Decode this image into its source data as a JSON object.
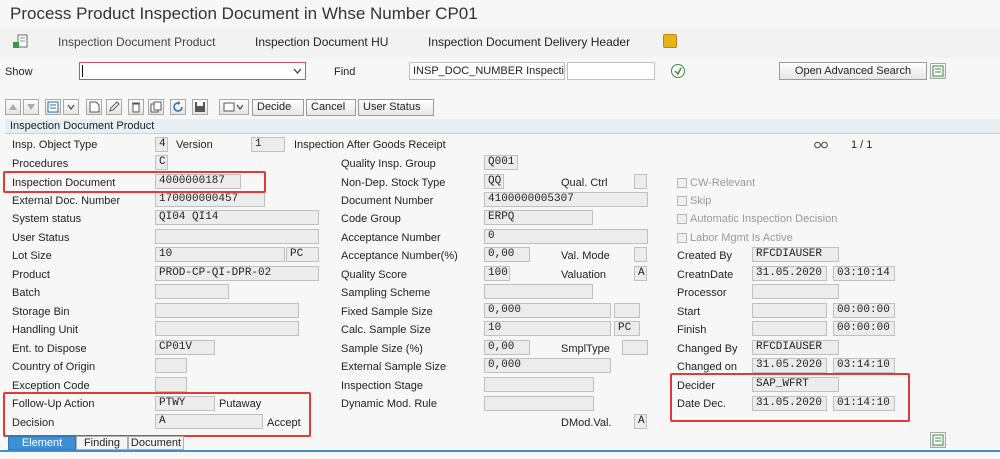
{
  "app": {
    "title": "Process Product Inspection Document in Whse Number CP01"
  },
  "nav": {
    "items": [
      "Inspection Document Product",
      "Inspection Document HU",
      "Inspection Document Delivery Header"
    ]
  },
  "search": {
    "show_label": "Show",
    "show_value": "",
    "find_label": "Find",
    "find_field": "INSP_DOC_NUMBER Inspecti…",
    "find_value": "",
    "advanced_label": "Open Advanced Search"
  },
  "toolbar": {
    "decide": "Decide",
    "cancel": "Cancel",
    "user_status": "User Status"
  },
  "panel": {
    "title": "Inspection Document Product",
    "pager": "1 / 1"
  },
  "top": {
    "insp_object_type_label": "Insp. Object Type",
    "insp_object_type": "4",
    "version_label": "Version",
    "version": "1",
    "description": "Inspection After Goods Receipt"
  },
  "left": {
    "procedures_label": "Procedures",
    "procedures": "C",
    "insp_doc_label": "Inspection Document",
    "insp_doc": "4000000187",
    "ext_doc_label": "External Doc. Number",
    "ext_doc": "170000000457",
    "sys_status_label": "System status",
    "sys_status": "QI04 QI14",
    "user_status_label": "User Status",
    "user_status": "",
    "lot_size_label": "Lot Size",
    "lot_size": "10",
    "lot_size_uom": "PC",
    "product_label": "Product",
    "product": "PROD-CP-QI-DPR-02",
    "batch_label": "Batch",
    "batch": "",
    "storage_bin_label": "Storage Bin",
    "storage_bin": "",
    "handling_unit_label": "Handling Unit",
    "handling_unit": "",
    "ent_dispose_label": "Ent. to Dispose",
    "ent_dispose": "CP01V",
    "country_label": "Country of Origin",
    "country": "",
    "exception_label": "Exception Code",
    "exception": "",
    "followup_label": "Follow-Up Action",
    "followup": "PTWY",
    "followup_text": "Putaway",
    "decision_label": "Decision",
    "decision": "A",
    "decision_text": "Accept"
  },
  "middle": {
    "qig_label": "Quality Insp. Group",
    "qig": "Q001",
    "nondep_label": "Non-Dep. Stock Type",
    "nondep": "QQ",
    "qual_ctrl_label": "Qual. Ctrl",
    "qual_ctrl": "",
    "doc_num_label": "Document Number",
    "doc_num": "4100000005307",
    "code_group_label": "Code Group",
    "code_group": "ERPQ",
    "acc_num_label": "Acceptance Number",
    "acc_num": "0",
    "acc_num_pct_label": "Acceptance Number(%)",
    "acc_num_pct": "0,00",
    "val_mode_label": "Val. Mode",
    "val_mode": "",
    "qual_score_label": "Quality Score",
    "qual_score": "100",
    "valuation_label": "Valuation",
    "valuation": "A",
    "sampling_label": "Sampling Scheme",
    "sampling": "",
    "fixed_sample_label": "Fixed Sample Size",
    "fixed_sample": "0,000",
    "calc_sample_label": "Calc. Sample Size",
    "calc_sample": "10",
    "calc_sample_uom": "PC",
    "sample_pct_label": "Sample Size (%)",
    "sample_pct": "0,00",
    "smpl_type_label": "SmplType",
    "smpl_type": "",
    "ext_sample_label": "External Sample Size",
    "ext_sample": "0,000",
    "insp_stage_label": "Inspection Stage",
    "insp_stage": "",
    "dyn_rule_label": "Dynamic Mod. Rule",
    "dyn_rule": "",
    "dmod_label": "DMod.Val.",
    "dmod": "A"
  },
  "right": {
    "cw_relevant": "CW-Relevant",
    "skip": "Skip",
    "auto_decision": "Automatic Inspection Decision",
    "labor_mgmt": "Labor Mgmt Is Active",
    "created_by_label": "Created By",
    "created_by": "RFCDIAUSER",
    "creatn_date_label": "CreatnDate",
    "creatn_date": "31.05.2020",
    "creatn_time": "03:10:14",
    "processor_label": "Processor",
    "processor": "",
    "start_label": "Start",
    "start_date": "",
    "start_time": "00:00:00",
    "finish_label": "Finish",
    "finish_date": "",
    "finish_time": "00:00:00",
    "changed_by_label": "Changed By",
    "changed_by": "RFCDIAUSER",
    "changed_on_label": "Changed on",
    "changed_on_date": "31.05.2020",
    "changed_on_time": "03:14:10",
    "decider_label": "Decider",
    "decider": "SAP_WFRT",
    "date_dec_label": "Date Dec.",
    "date_dec": "31.05.2020",
    "time_dec": "01:14:10"
  },
  "tabs": [
    "Element",
    "Finding",
    "Document"
  ],
  "colors": {
    "accent": "#3d8fd6",
    "highlight": "#e03a3a",
    "panel_header": "#e9eef3"
  }
}
